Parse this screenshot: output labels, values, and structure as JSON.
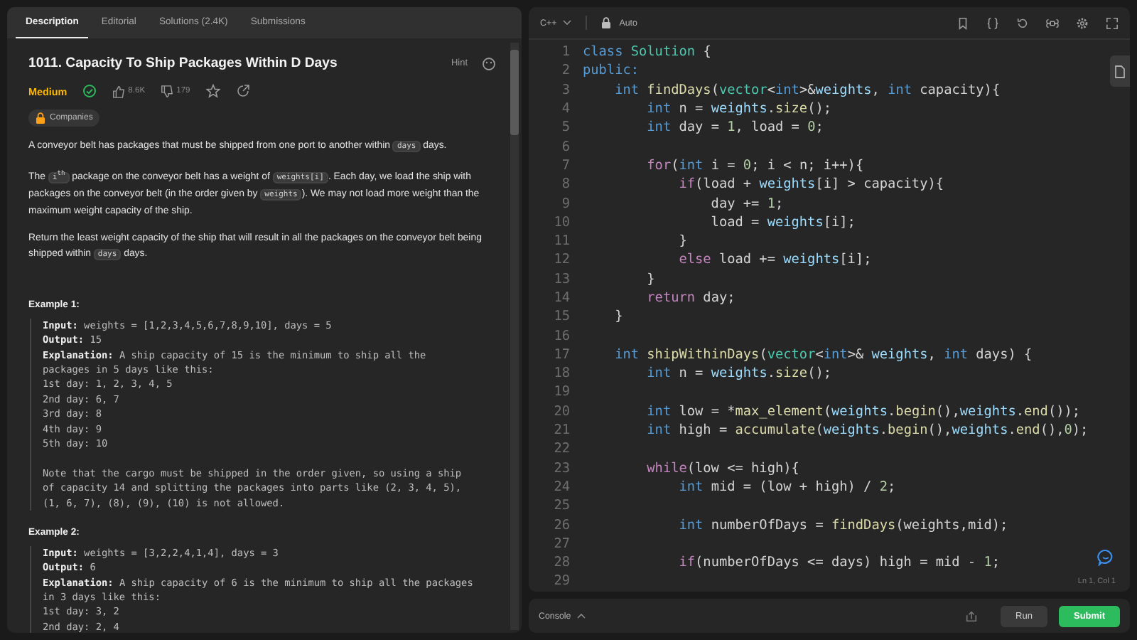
{
  "tabs": [
    {
      "label": "Description",
      "selected": true
    },
    {
      "label": "Editorial",
      "selected": false
    },
    {
      "label": "Solutions (2.4K)",
      "selected": false
    },
    {
      "label": "Submissions",
      "selected": false
    }
  ],
  "problem": {
    "title": "1011. Capacity To Ship Packages Within D Days",
    "hint": "Hint",
    "difficulty": "Medium",
    "solved": true,
    "likes": "8.6K",
    "dislikes": "179",
    "tag": "Companies"
  },
  "paragraphs": [
    [
      {
        "kind": "text",
        "text": "A conveyor belt has packages that must be shipped from one port to another within "
      },
      {
        "kind": "code",
        "text": "days"
      },
      {
        "kind": "text",
        "text": " days."
      }
    ],
    [
      {
        "kind": "text",
        "text": "The "
      },
      {
        "kind": "code",
        "text": "i$^{th}$"
      },
      {
        "kind": "text",
        "text": " package on the conveyor belt has a weight of "
      },
      {
        "kind": "code",
        "text": "weights[i]"
      },
      {
        "kind": "text",
        "text": ". Each day, we load the ship with packages on the conveyor belt (in the order given by "
      },
      {
        "kind": "code",
        "text": "weights"
      },
      {
        "kind": "text",
        "text": "). We may not load more weight than the maximum weight capacity of the ship."
      }
    ],
    [
      {
        "kind": "text",
        "text": "Return the least weight capacity of the ship that will result in all the packages on the conveyor belt being shipped within "
      },
      {
        "kind": "code",
        "text": "days"
      },
      {
        "kind": "text",
        "text": " days."
      }
    ]
  ],
  "examples": [
    {
      "title": "Example 1:",
      "lines": [
        "**Input:** weights = [1,2,3,4,5,6,7,8,9,10], days = 5",
        "**Output:** 15",
        "**Explanation:** A ship capacity of 15 is the minimum to ship all the",
        "packages in 5 days like this:",
        "1st day: 1, 2, 3, 4, 5",
        "2nd day: 6, 7",
        "3rd day: 8",
        "4th day: 9",
        "5th day: 10"
      ],
      "note_lines": [
        "Note that the cargo must be shipped in the order given, so using a ship",
        "of capacity 14 and splitting the packages into parts like (2, 3, 4, 5),",
        "(1, 6, 7), (8), (9), (10) is not allowed."
      ]
    },
    {
      "title": "Example 2:",
      "lines": [
        "**Input:** weights = [3,2,2,4,1,4], days = 3",
        "**Output:** 6",
        "**Explanation:** A ship capacity of 6 is the minimum to ship all the packages",
        "in 3 days like this:",
        "1st day: 3, 2",
        "2nd day: 2, 4"
      ]
    }
  ],
  "editor": {
    "language": "C++",
    "mode": "Auto",
    "cursor": "Ln 1, Col 1",
    "lines": [
      {
        "number": "1",
        "tokens": [
          {
            "kind": "kw",
            "text": "class"
          },
          {
            "kind": "ty",
            "text": " Solution"
          },
          {
            "kind": "pl",
            "text": " {"
          }
        ]
      },
      {
        "number": "2",
        "tokens": [
          {
            "kind": "kw",
            "text": "public:"
          }
        ]
      },
      {
        "number": "3",
        "tokens": [
          {
            "kind": "kw",
            "text": "    int"
          },
          {
            "kind": "fn",
            "text": " findDays"
          },
          {
            "kind": "pl",
            "text": "("
          },
          {
            "kind": "ty",
            "text": "vector"
          },
          {
            "kind": "pl",
            "text": "<"
          },
          {
            "kind": "kw",
            "text": "int"
          },
          {
            "kind": "pl",
            "text": ">&"
          },
          {
            "kind": "va",
            "text": "weights"
          },
          {
            "kind": "pl",
            "text": ", "
          },
          {
            "kind": "kw",
            "text": "int"
          },
          {
            "kind": "pl",
            "text": " capacity){"
          }
        ]
      },
      {
        "number": "4",
        "tokens": [
          {
            "kind": "kw",
            "text": "        int"
          },
          {
            "kind": "pl",
            "text": " n = "
          },
          {
            "kind": "va",
            "text": "weights"
          },
          {
            "kind": "pl",
            "text": "."
          },
          {
            "kind": "fn",
            "text": "size"
          },
          {
            "kind": "pl",
            "text": "();"
          }
        ]
      },
      {
        "number": "5",
        "tokens": [
          {
            "kind": "kw",
            "text": "        int"
          },
          {
            "kind": "pl",
            "text": " day = "
          },
          {
            "kind": "nu",
            "text": "1"
          },
          {
            "kind": "pl",
            "text": ", load = "
          },
          {
            "kind": "nu",
            "text": "0"
          },
          {
            "kind": "pl",
            "text": ";"
          }
        ]
      },
      {
        "number": "6"
      },
      {
        "number": "7",
        "tokens": [
          {
            "kind": "ct",
            "text": "        for"
          },
          {
            "kind": "pl",
            "text": "("
          },
          {
            "kind": "kw",
            "text": "int"
          },
          {
            "kind": "pl",
            "text": " i = "
          },
          {
            "kind": "nu",
            "text": "0"
          },
          {
            "kind": "pl",
            "text": "; i < n; i++){"
          }
        ]
      },
      {
        "number": "8",
        "tokens": [
          {
            "kind": "ct",
            "text": "            if"
          },
          {
            "kind": "pl",
            "text": "(load + "
          },
          {
            "kind": "va",
            "text": "weights"
          },
          {
            "kind": "pl",
            "text": "[i] > capacity){"
          }
        ]
      },
      {
        "number": "9",
        "tokens": [
          {
            "kind": "pl",
            "text": "                day += "
          },
          {
            "kind": "nu",
            "text": "1"
          },
          {
            "kind": "pl",
            "text": ";"
          }
        ]
      },
      {
        "number": "10",
        "tokens": [
          {
            "kind": "pl",
            "text": "                load = "
          },
          {
            "kind": "va",
            "text": "weights"
          },
          {
            "kind": "pl",
            "text": "[i];"
          }
        ]
      },
      {
        "number": "11",
        "tokens": [
          {
            "kind": "pl",
            "text": "            }"
          }
        ]
      },
      {
        "number": "12",
        "tokens": [
          {
            "kind": "ct",
            "text": "            else"
          },
          {
            "kind": "pl",
            "text": " load += "
          },
          {
            "kind": "va",
            "text": "weights"
          },
          {
            "kind": "pl",
            "text": "[i];"
          }
        ]
      },
      {
        "number": "13",
        "tokens": [
          {
            "kind": "pl",
            "text": "        }"
          }
        ]
      },
      {
        "number": "14",
        "tokens": [
          {
            "kind": "ct",
            "text": "        return"
          },
          {
            "kind": "pl",
            "text": " day;"
          }
        ]
      },
      {
        "number": "15",
        "tokens": [
          {
            "kind": "pl",
            "text": "    }"
          }
        ]
      },
      {
        "number": "16"
      },
      {
        "number": "17",
        "tokens": [
          {
            "kind": "kw",
            "text": "    int"
          },
          {
            "kind": "fn",
            "text": " shipWithinDays"
          },
          {
            "kind": "pl",
            "text": "("
          },
          {
            "kind": "ty",
            "text": "vector"
          },
          {
            "kind": "pl",
            "text": "<"
          },
          {
            "kind": "kw",
            "text": "int"
          },
          {
            "kind": "pl",
            "text": ">& "
          },
          {
            "kind": "va",
            "text": "weights"
          },
          {
            "kind": "pl",
            "text": ", "
          },
          {
            "kind": "kw",
            "text": "int"
          },
          {
            "kind": "pl",
            "text": " days) {"
          }
        ]
      },
      {
        "number": "18",
        "tokens": [
          {
            "kind": "kw",
            "text": "        int"
          },
          {
            "kind": "pl",
            "text": " n = "
          },
          {
            "kind": "va",
            "text": "weights"
          },
          {
            "kind": "pl",
            "text": "."
          },
          {
            "kind": "fn",
            "text": "size"
          },
          {
            "kind": "pl",
            "text": "();"
          }
        ]
      },
      {
        "number": "19"
      },
      {
        "number": "20",
        "tokens": [
          {
            "kind": "kw",
            "text": "        int"
          },
          {
            "kind": "pl",
            "text": " low = *"
          },
          {
            "kind": "fn",
            "text": "max_element"
          },
          {
            "kind": "pl",
            "text": "("
          },
          {
            "kind": "va",
            "text": "weights"
          },
          {
            "kind": "pl",
            "text": "."
          },
          {
            "kind": "fn",
            "text": "begin"
          },
          {
            "kind": "pl",
            "text": "(),"
          },
          {
            "kind": "va",
            "text": "weights"
          },
          {
            "kind": "pl",
            "text": "."
          },
          {
            "kind": "fn",
            "text": "end"
          },
          {
            "kind": "pl",
            "text": "());"
          }
        ]
      },
      {
        "number": "21",
        "tokens": [
          {
            "kind": "kw",
            "text": "        int"
          },
          {
            "kind": "pl",
            "text": " high = "
          },
          {
            "kind": "fn",
            "text": "accumulate"
          },
          {
            "kind": "pl",
            "text": "("
          },
          {
            "kind": "va",
            "text": "weights"
          },
          {
            "kind": "pl",
            "text": "."
          },
          {
            "kind": "fn",
            "text": "begin"
          },
          {
            "kind": "pl",
            "text": "(),"
          },
          {
            "kind": "va",
            "text": "weights"
          },
          {
            "kind": "pl",
            "text": "."
          },
          {
            "kind": "fn",
            "text": "end"
          },
          {
            "kind": "pl",
            "text": "(),"
          },
          {
            "kind": "nu",
            "text": "0"
          },
          {
            "kind": "pl",
            "text": ");"
          }
        ]
      },
      {
        "number": "22"
      },
      {
        "number": "23",
        "tokens": [
          {
            "kind": "ct",
            "text": "        while"
          },
          {
            "kind": "pl",
            "text": "(low <= high){"
          }
        ]
      },
      {
        "number": "24",
        "tokens": [
          {
            "kind": "kw",
            "text": "            int"
          },
          {
            "kind": "pl",
            "text": " mid = (low + high) / "
          },
          {
            "kind": "nu",
            "text": "2"
          },
          {
            "kind": "pl",
            "text": ";"
          }
        ]
      },
      {
        "number": "25"
      },
      {
        "number": "26",
        "tokens": [
          {
            "kind": "kw",
            "text": "            int"
          },
          {
            "kind": "pl",
            "text": " numberOfDays = "
          },
          {
            "kind": "fn",
            "text": "findDays"
          },
          {
            "kind": "pl",
            "text": "(weights,mid);"
          }
        ]
      },
      {
        "number": "27"
      },
      {
        "number": "28",
        "tokens": [
          {
            "kind": "ct",
            "text": "            if"
          },
          {
            "kind": "pl",
            "text": "(numberOfDays <= days) high = mid - "
          },
          {
            "kind": "nu",
            "text": "1"
          },
          {
            "kind": "pl",
            "text": ";"
          }
        ]
      },
      {
        "number": "29"
      }
    ]
  },
  "console": {
    "label": "Console",
    "run": "Run",
    "submit": "Submit"
  }
}
